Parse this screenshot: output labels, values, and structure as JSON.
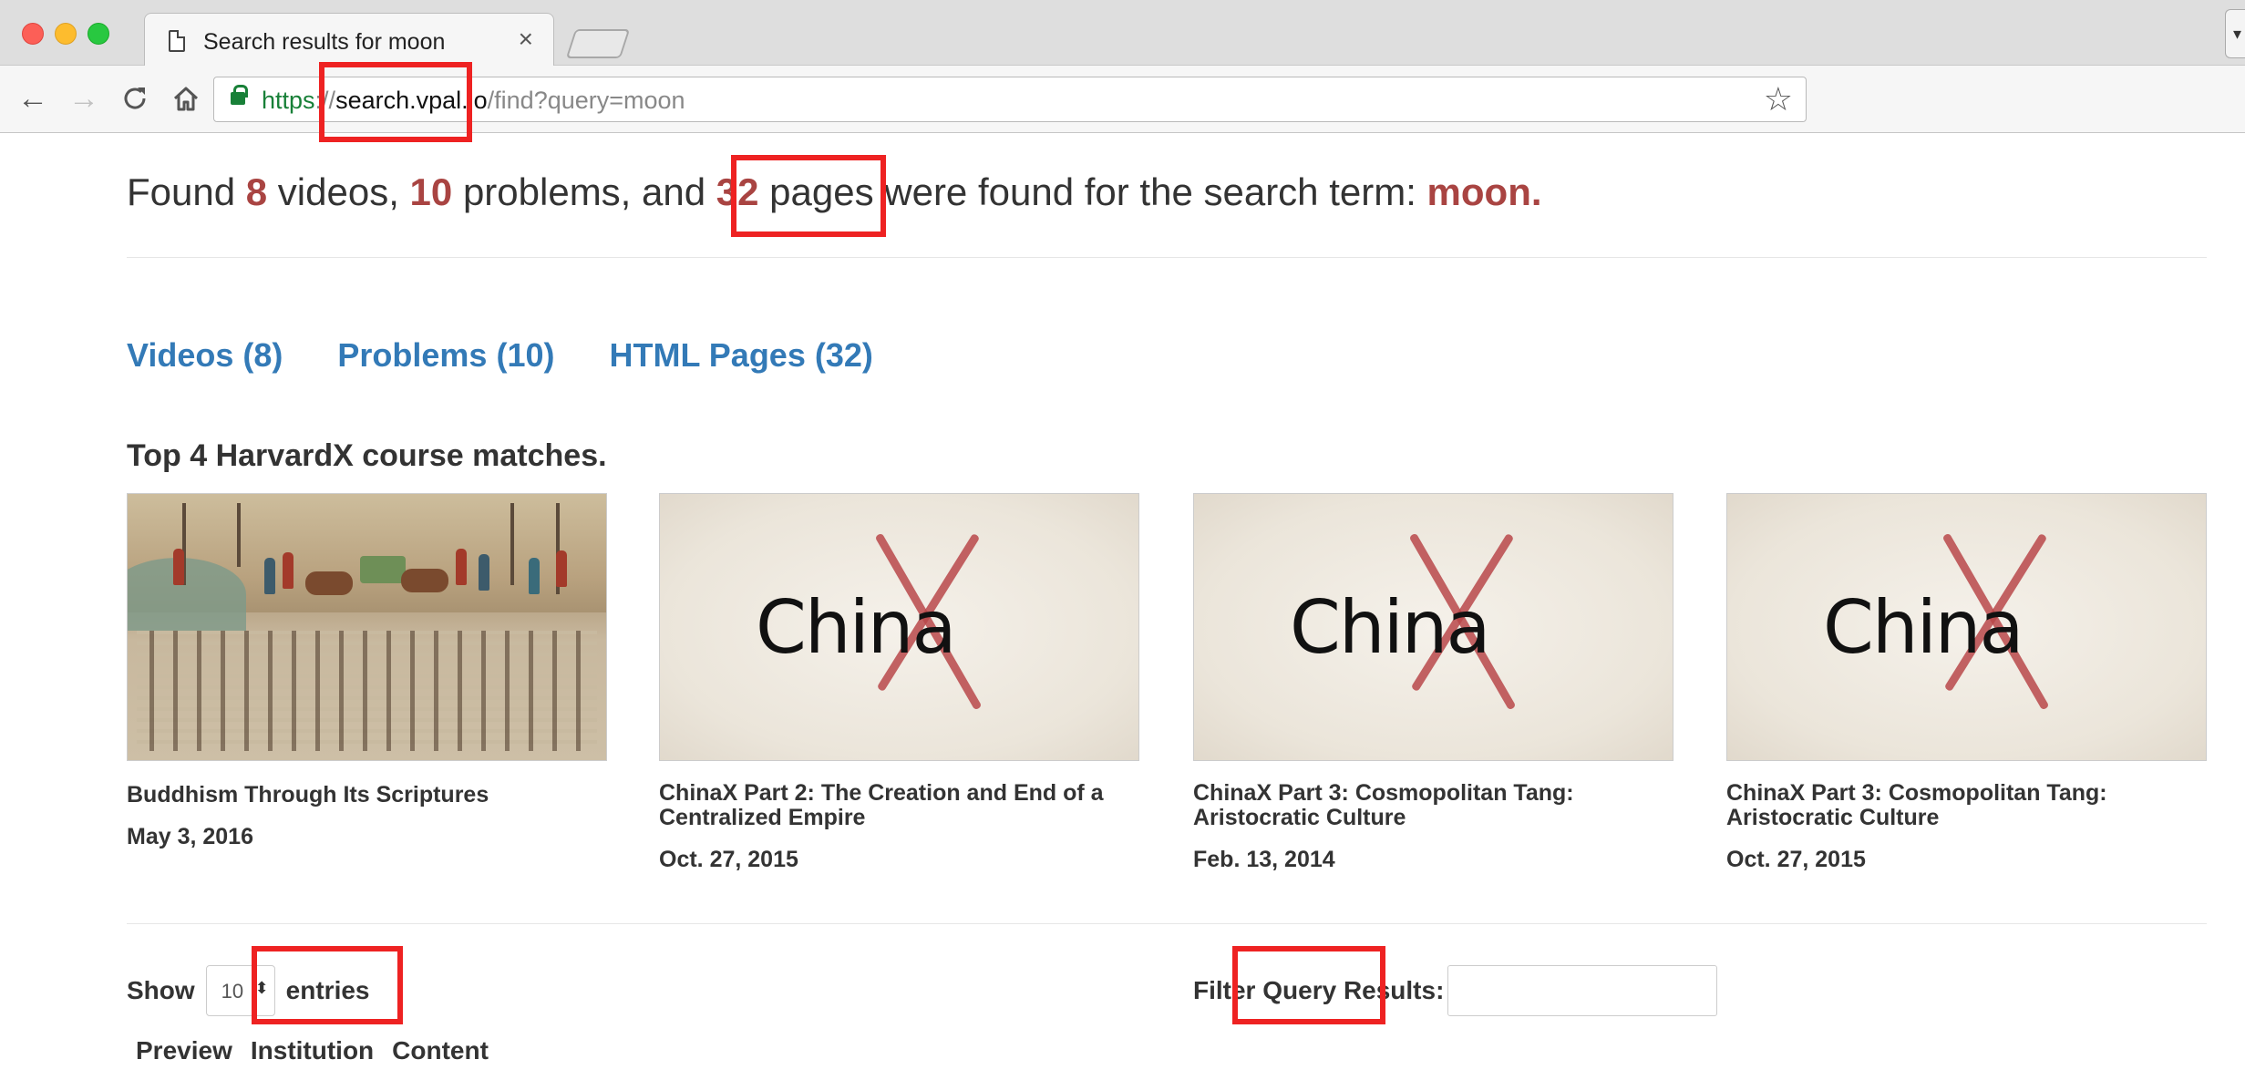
{
  "browser": {
    "tab_title": "Search results for moon",
    "tab_close": "×",
    "url_scheme": "https",
    "url_sep": "://",
    "url_host": "search.vpal.io",
    "url_path": "/find?query=moon",
    "menu_glyph": "▾"
  },
  "summary": {
    "prefix": "Found",
    "videos_count": "8",
    "videos_word": "videos,",
    "problems_count": "10",
    "problems_word": "problems, and",
    "pages_count": "32",
    "pages_word": "pages were found for the search term:",
    "term": "moon."
  },
  "result_tabs": [
    {
      "label": "Videos (8)"
    },
    {
      "label": "Problems (10)"
    },
    {
      "label": "HTML Pages (32)"
    }
  ],
  "matches_heading": "Top 4 HarvardX course matches.",
  "courses": [
    {
      "title": "Buddhism Through Its Scriptures",
      "date": "May 3, 2016",
      "thumbnail": "scroll-painting"
    },
    {
      "title": "ChinaX Part 2: The Creation and End of a Centralized Empire",
      "date": "Oct. 27, 2015",
      "thumbnail": "chinax-logo",
      "thumb_text": "China"
    },
    {
      "title": "ChinaX Part 3: Cosmopolitan Tang: Aristocratic Culture",
      "date": "Feb. 13, 2014",
      "thumbnail": "chinax-logo",
      "thumb_text": "China"
    },
    {
      "title": "ChinaX Part 3: Cosmopolitan Tang: Aristocratic Culture",
      "date": "Oct. 27, 2015",
      "thumbnail": "chinax-logo",
      "thumb_text": "China"
    }
  ],
  "table_controls": {
    "show_label": "Show",
    "entries_value": "10",
    "entries_label": "entries",
    "filter_label": "Filter Query Results:",
    "filter_value": ""
  },
  "table_headers": [
    "Preview",
    "Institution",
    "Content"
  ],
  "colors": {
    "highlight": "#a94442",
    "link": "#337ab7",
    "annotation": "#ee2222"
  }
}
